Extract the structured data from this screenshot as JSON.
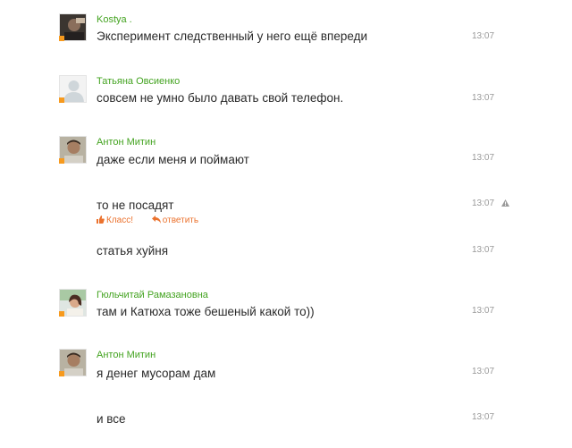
{
  "messages": [
    {
      "author": "Kostya .",
      "text": "Эксперимент следственный у него ещё впереди",
      "time": "13:07",
      "avatar": "photo-dark"
    },
    {
      "author": "Татьяна Овсиенко",
      "text": "совсем не умно было давать свой телефон.",
      "time": "13:07",
      "avatar": "placeholder-user-icon"
    },
    {
      "author": "Антон Митин",
      "text": "даже если меня и поймают",
      "time": "13:07",
      "avatar": "photo-man"
    },
    {
      "text": "то не посадят",
      "time": "13:07",
      "actions": {
        "like_label": "Класс!",
        "reply_label": "ответить"
      }
    },
    {
      "text": "статья хуйня",
      "time": "13:07"
    },
    {
      "author": "Гюльчитай Рамазановна",
      "text": "там и Катюха тоже бешеный какой то))",
      "time": "13:07",
      "avatar": "photo-woman"
    },
    {
      "author": "Антон Митин",
      "text": "я денег мусорам дам",
      "time": "13:07",
      "avatar": "photo-man"
    },
    {
      "text": "и все",
      "time": "13:07"
    }
  ],
  "colors": {
    "author": "#43a320",
    "text": "#2a2a2a",
    "time": "#999999",
    "presence": "#f79a1e",
    "action": "#eb722e"
  },
  "icons": [
    "presence-indicator-icon",
    "warning-triangle-icon",
    "thumbs-up-icon",
    "reply-arrow-icon"
  ]
}
